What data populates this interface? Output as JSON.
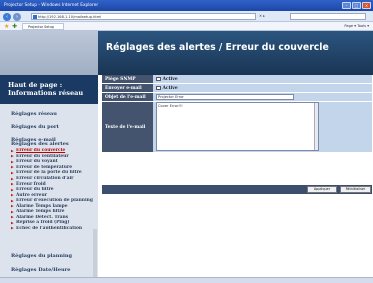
{
  "browser": {
    "title": "Projector Setup - Windows Internet Explorer",
    "url": "http://192.168.1.10/mailsetup.html",
    "tab": "Projector Setup",
    "tools": "Page ▾  Tools ▾",
    "go": "✕  ▸"
  },
  "sidebar": {
    "header": "Haut de page : Informations réseau",
    "links": [
      "Réglages réseau",
      "Réglages du port",
      "Réglages e-mail",
      "Réglages des alertes"
    ],
    "alert_items": [
      "Erreur du couvercle",
      "Erreur du ventilateur",
      "Erreur du voyant",
      "Erreur de température",
      "Erreur de la porte du filtre",
      "Erreur circulation d'air",
      "Erreur froid",
      "Erreur du filtre",
      "Autre erreur",
      "Erreur d'exécution de planning",
      "Alarme Temps lampe",
      "Alarme Temps filtre",
      "Alarme Détect. Trans",
      "Reprise à froid (Ping)",
      "Échec de l'authentification"
    ],
    "bottom_links": [
      "Réglages du planning",
      "Réglages Date/Heure"
    ]
  },
  "main": {
    "title": "Réglages des alertes / Erreur du couvercle",
    "fields": {
      "snmp_label": "Piège SNMP",
      "snmp_value": "Active",
      "email_label": "Envoyer e-mail",
      "email_value": "Active",
      "subject_label": "Objet de l'e-mail",
      "subject_value": "Projector Error",
      "body_label": "Texte de l'e-mail",
      "body_value": "Cover Error!!!"
    },
    "buttons": {
      "apply": "Appliquer",
      "reset": "Réinitialiser"
    }
  },
  "colors": {
    "banner": "#1f3d60",
    "label_bg": "#44546e",
    "value_bg": "#c2d5ea",
    "active_link": "#b00000"
  }
}
